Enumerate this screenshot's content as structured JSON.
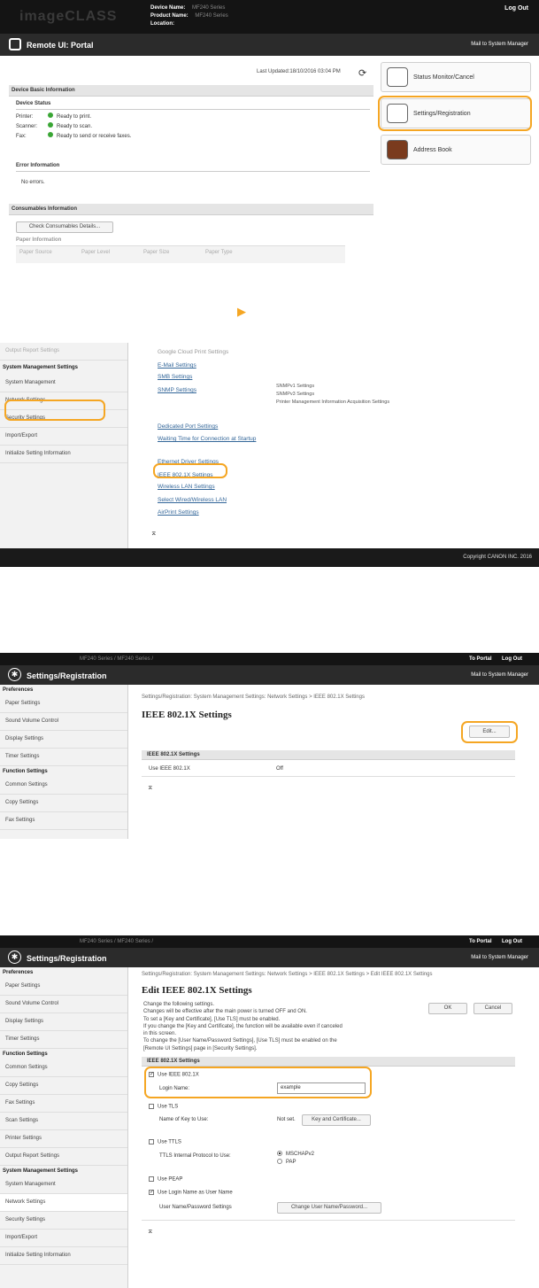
{
  "s1": {
    "device_name_label": "Device Name:",
    "device_name_value": "MF240 Series",
    "product_name_label": "Product Name:",
    "product_name_value": "MF240 Series",
    "location_label": "Location:",
    "logout": "Log Out",
    "brand": "imageCLASS",
    "title": "Remote UI: Portal",
    "mail": "Mail to System Manager",
    "last_updated": "Last Updated:18/10/2016 03:04 PM",
    "basic_info": "Device Basic Information",
    "device_status": "Device Status",
    "statuses": [
      {
        "label": "Printer:",
        "value": "Ready to print."
      },
      {
        "label": "Scanner:",
        "value": "Ready to scan."
      },
      {
        "label": "Fax:",
        "value": "Ready to send or receive faxes."
      }
    ],
    "error_info": "Error Information",
    "no_errors": "No errors.",
    "consumables": "Consumables Information",
    "check_consumables": "Check Consumables Details...",
    "paper_info": "Paper Information",
    "paper_cols": [
      "Paper Source",
      "Paper Level",
      "Paper Size",
      "Paper Type"
    ],
    "menu": [
      {
        "label": "Status Monitor/Cancel",
        "icon": "status-monitor-icon"
      },
      {
        "label": "Settings/Registration",
        "icon": "settings-registration-icon"
      },
      {
        "label": "Address Book",
        "icon": "address-book-icon"
      }
    ]
  },
  "arrow": "▶",
  "s2": {
    "side": [
      "Output Report Settings",
      "System Management Settings",
      "System Management",
      "Network Settings",
      "Security Settings",
      "Import/Export",
      "Initialize Setting Information"
    ],
    "links": [
      "Google Cloud Print Settings",
      "E-Mail Settings",
      "SMB Settings",
      "SNMP Settings",
      "Dedicated Port Settings",
      "Waiting Time for Connection at Startup",
      "Ethernet Driver Settings",
      "IEEE 802.1X Settings",
      "Wireless LAN Settings",
      "Select Wired/Wireless LAN",
      "AirPrint Settings"
    ],
    "snmp_sub": [
      "SNMPv1 Settings",
      "SNMPv3 Settings",
      "Printer Management Information Acquisition Settings"
    ],
    "top_icon": "⌅",
    "copyright": "Copyright CANON INC. 2016"
  },
  "s3": {
    "breadcrumb_top": "MF240 Series / MF240 Series /",
    "to_portal": "To Portal",
    "logout": "Log Out",
    "title": "Settings/Registration",
    "mail": "Mail to System Manager",
    "side": [
      {
        "t": "h",
        "label": "Preferences"
      },
      {
        "t": "i",
        "label": "Paper Settings"
      },
      {
        "t": "i",
        "label": "Sound Volume Control"
      },
      {
        "t": "i",
        "label": "Display Settings"
      },
      {
        "t": "i",
        "label": "Timer Settings"
      },
      {
        "t": "h",
        "label": "Function Settings"
      },
      {
        "t": "i",
        "label": "Common Settings"
      },
      {
        "t": "i",
        "label": "Copy Settings"
      },
      {
        "t": "i",
        "label": "Fax Settings"
      }
    ],
    "crumb": "Settings/Registration: System Management Settings: Network Settings > IEEE 802.1X Settings",
    "heading": "IEEE 802.1X Settings",
    "edit": "Edit...",
    "section": "IEEE 802.1X Settings",
    "row_label": "Use IEEE 802.1X",
    "row_value": "Off",
    "top_icon": "⌅"
  },
  "s4": {
    "breadcrumb_top": "MF240 Series / MF240 Series /",
    "to_portal": "To Portal",
    "logout": "Log Out",
    "title": "Settings/Registration",
    "mail": "Mail to System Manager",
    "side": [
      {
        "t": "h",
        "label": "Preferences"
      },
      {
        "t": "i",
        "label": "Paper Settings"
      },
      {
        "t": "i",
        "label": "Sound Volume Control"
      },
      {
        "t": "i",
        "label": "Display Settings"
      },
      {
        "t": "i",
        "label": "Timer Settings"
      },
      {
        "t": "h",
        "label": "Function Settings"
      },
      {
        "t": "i",
        "label": "Common Settings"
      },
      {
        "t": "i",
        "label": "Copy Settings"
      },
      {
        "t": "i",
        "label": "Fax Settings"
      },
      {
        "t": "i",
        "label": "Scan Settings"
      },
      {
        "t": "i",
        "label": "Printer Settings"
      },
      {
        "t": "i",
        "label": "Output Report Settings"
      },
      {
        "t": "h",
        "label": "System Management Settings"
      },
      {
        "t": "i",
        "label": "System Management"
      },
      {
        "t": "i",
        "label": "Network Settings"
      },
      {
        "t": "i",
        "label": "Security Settings"
      },
      {
        "t": "i",
        "label": "Import/Export"
      },
      {
        "t": "i",
        "label": "Initialize Setting Information"
      }
    ],
    "crumb": "Settings/Registration: System Management Settings: Network Settings > IEEE 802.1X Settings > Edit IEEE 802.1X Settings",
    "heading": "Edit IEEE 802.1X Settings",
    "notes": [
      "Change the following settings.",
      "Changes will be effective after the main power is turned OFF and ON.",
      "To set a [Key and Certificate], [Use TLS] must be enabled.",
      "If you change the [Key and Certificate], the function will be available even if canceled",
      "in this screen.",
      "To change the [User Name/Password Settings], [Use TLS] must be enabled on the",
      "[Remote UI Settings] page in [Security Settings]."
    ],
    "ok": "OK",
    "cancel": "Cancel",
    "section": "IEEE 802.1X Settings",
    "use_ieee": "Use IEEE 802.1X",
    "login_label": "Login Name:",
    "login_value": "example",
    "use_tls": "Use TLS",
    "key_label": "Name of Key to Use:",
    "key_value": "Not set.",
    "key_btn": "Key and Certificate...",
    "use_ttls": "Use TTLS",
    "ttls_label": "TTLS Internal Protocol to Use:",
    "ttls_opts": [
      "MSCHAPv2",
      "PAP"
    ],
    "use_peap": "Use PEAP",
    "use_login": "Use Login Name as User Name",
    "userpw_label": "User Name/Password Settings",
    "userpw_btn": "Change User Name/Password...",
    "top_icon": "⌅"
  },
  "accent": "#f5a623"
}
